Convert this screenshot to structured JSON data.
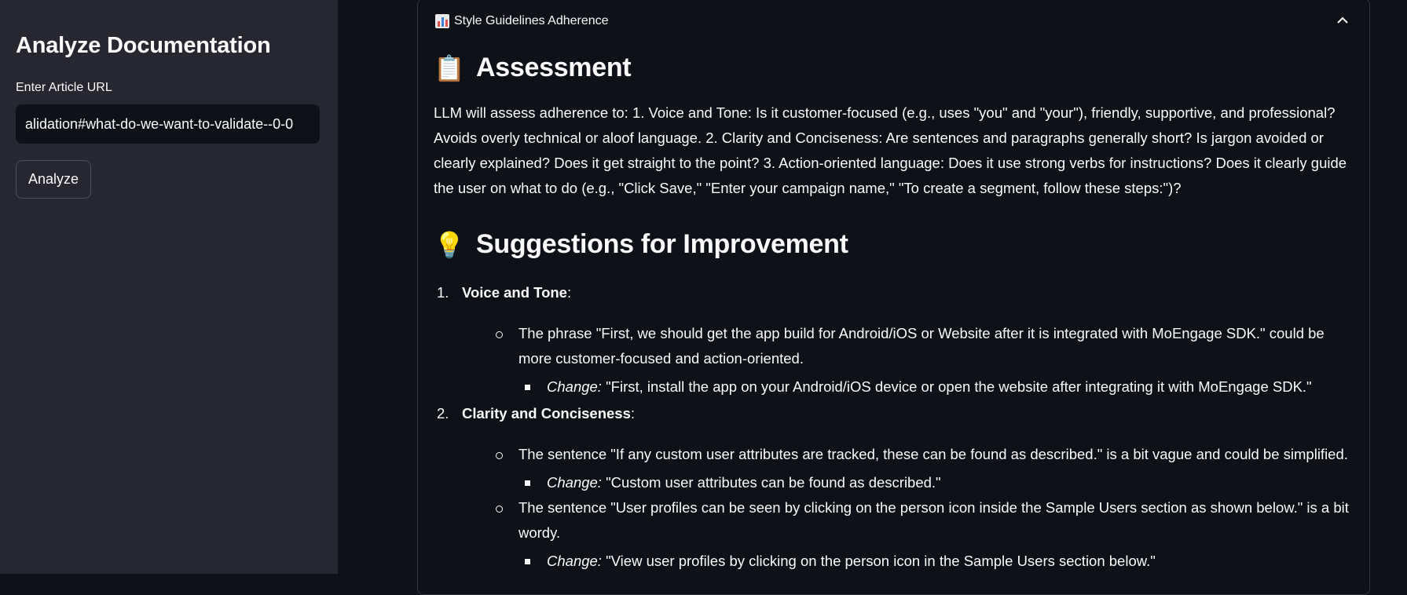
{
  "sidebar": {
    "title": "Analyze Documentation",
    "url_label": "Enter Article URL",
    "url_value": "alidation#what-do-we-want-to-validate--0-0",
    "analyze_label": "Analyze"
  },
  "expander": {
    "title": "Style Guidelines Adherence",
    "icon": "bar-chart-icon",
    "expanded": true
  },
  "assessment": {
    "emoji": "📋",
    "heading": "Assessment",
    "text": "LLM will assess adherence to: 1. Voice and Tone: Is it customer-focused (e.g., uses \"you\" and \"your\"), friendly, supportive, and professional? Avoids overly technical or aloof language. 2. Clarity and Conciseness: Are sentences and paragraphs generally short? Is jargon avoided or clearly explained? Does it get straight to the point? 3. Action-oriented language: Does it use strong verbs for instructions? Does it clearly guide the user on what to do (e.g., \"Click Save,\" \"Enter your campaign name,\" \"To create a segment, follow these steps:\")?"
  },
  "suggestions": {
    "emoji": "💡",
    "heading": "Suggestions for Improvement",
    "items": [
      {
        "num": "1.",
        "title": "Voice and Tone",
        "points": [
          {
            "text": "The phrase \"First, we should get the app build for Android/iOS or Website after it is integrated with MoEngage SDK.\" could be more customer-focused and action-oriented.",
            "change_label": "Change:",
            "change_text": " \"First, install the app on your Android/iOS device or open the website after integrating it with MoEngage SDK.\""
          }
        ]
      },
      {
        "num": "2.",
        "title": "Clarity and Conciseness",
        "points": [
          {
            "text": "The sentence \"If any custom user attributes are tracked, these can be found as described.\" is a bit vague and could be simplified.",
            "change_label": "Change:",
            "change_text": " \"Custom user attributes can be found as described.\""
          },
          {
            "text": "The sentence \"User profiles can be seen by clicking on the person icon inside the Sample Users section as shown below.\" is a bit wordy.",
            "change_label": "Change:",
            "change_text": " \"View user profiles by clicking on the person icon in the Sample Users section below.\""
          }
        ]
      }
    ]
  }
}
